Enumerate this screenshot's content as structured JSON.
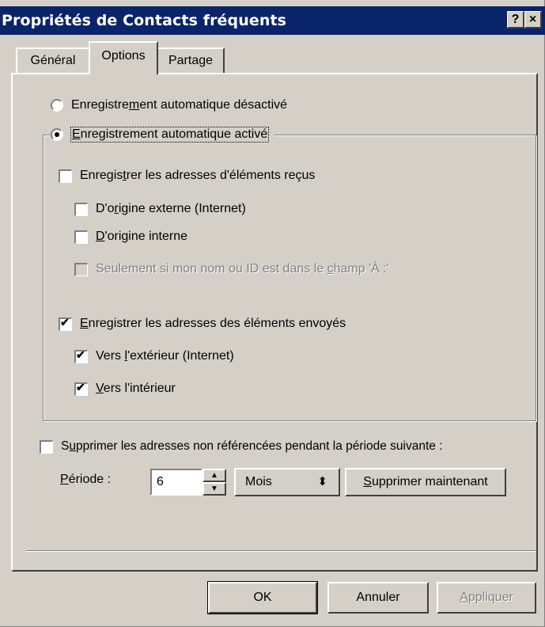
{
  "window": {
    "title": "Propriétés de Contacts fréquents",
    "help_label": "?",
    "close_label": "×"
  },
  "tabs": [
    {
      "label": "Général",
      "selected": false
    },
    {
      "label": "Options",
      "selected": true
    },
    {
      "label": "Partage",
      "selected": false
    }
  ],
  "auto_save": {
    "off": {
      "pre": "Enregistre",
      "u": "m",
      "post": "ent automatique désactivé",
      "selected": false
    },
    "on": {
      "pre": "",
      "u": "E",
      "post": "nregistrement automatique activé",
      "selected": true
    }
  },
  "received": {
    "main": {
      "pre": "Enregis",
      "u": "t",
      "post": "rer les adresses d'éléments reçus",
      "checked": false
    },
    "external": {
      "pre": "D'o",
      "u": "r",
      "post": "igine externe (Internet)",
      "checked": false
    },
    "internal": {
      "pre": "",
      "u": "D",
      "post": "'origine interne",
      "checked": false
    },
    "only_if": {
      "pre": "Seulement si mon nom ou ID est dans le ",
      "u": "c",
      "post": "hamp 'À :'",
      "checked": false,
      "disabled": true
    }
  },
  "sent": {
    "main": {
      "pre": "",
      "u": "E",
      "post": "nregistrer les adresses des éléments envoyés",
      "checked": true
    },
    "outside": {
      "pre": "Vers ",
      "u": "l",
      "post": "'extérieur (Internet)",
      "checked": true
    },
    "inside": {
      "pre": "",
      "u": "V",
      "post": "ers l'intérieur",
      "checked": true
    }
  },
  "purge": {
    "main": {
      "pre": "S",
      "u": "u",
      "post": "pprimer les adresses non référencées pendant la période suivante :",
      "checked": false
    },
    "period_label": {
      "pre": "",
      "u": "P",
      "post": "ériode :"
    },
    "period_value": "6",
    "unit_value": "Mois",
    "delete_now": {
      "pre": "",
      "u": "S",
      "post": "upprimer maintenant"
    }
  },
  "buttons": {
    "ok": "OK",
    "cancel": "Annuler",
    "apply": {
      "pre": "",
      "u": "A",
      "post": "ppliquer",
      "disabled": true
    }
  }
}
